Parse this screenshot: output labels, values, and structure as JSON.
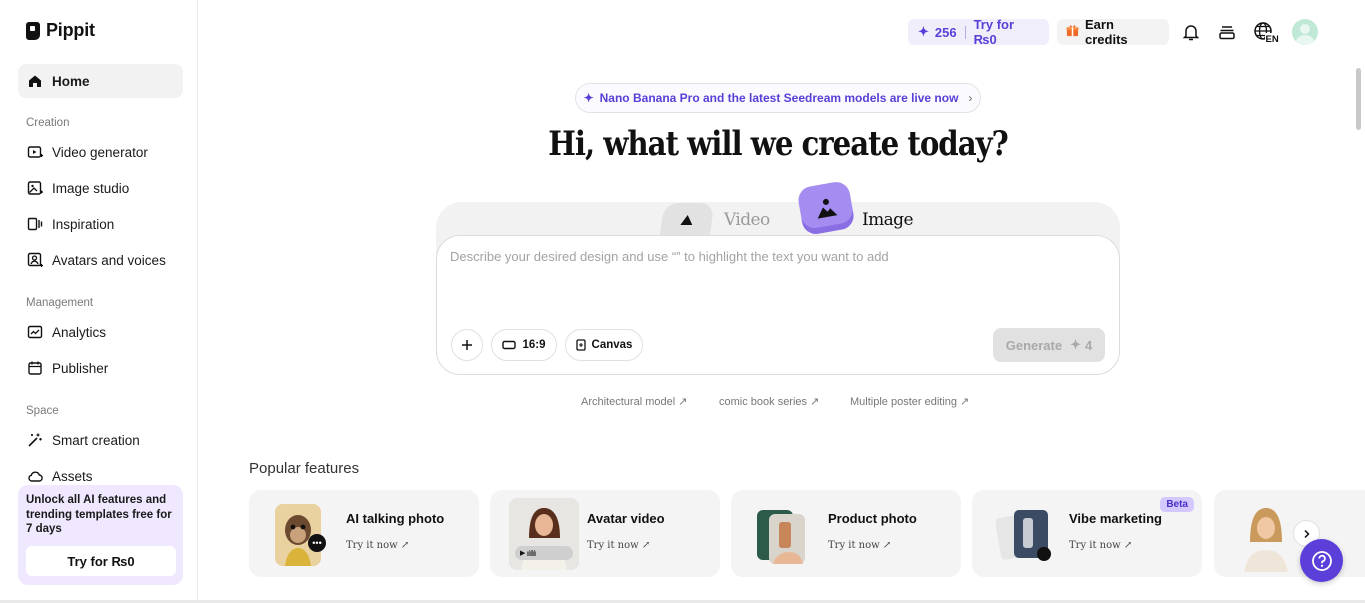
{
  "brand": {
    "name": "Pippit"
  },
  "sidebar": {
    "home": "Home",
    "sections": {
      "creation": "Creation",
      "management": "Management",
      "space": "Space"
    },
    "creation_items": [
      "Video generator",
      "Image studio",
      "Inspiration",
      "Avatars and voices"
    ],
    "management_items": [
      "Analytics",
      "Publisher"
    ],
    "space_items": [
      "Smart creation",
      "Assets"
    ],
    "promo": {
      "text": "Unlock all AI features and trending templates free for 7 days",
      "button": "Try for ₨0"
    }
  },
  "topbar": {
    "credits": "256",
    "try_label": "Try for ₨0",
    "earn_label": "Earn credits",
    "language": "EN"
  },
  "announcement": "Nano Banana Pro and the latest Seedream models are live now",
  "headline": "Hi, what will we create today?",
  "composer": {
    "mode_video": "Video",
    "mode_image": "Image",
    "placeholder": "Describe your desired design and use “” to highlight the text you want to add",
    "aspect": "16:9",
    "canvas": "Canvas",
    "generate": "Generate",
    "generate_cost": "4"
  },
  "suggestions": [
    "Architectural model ↗",
    "comic book series ↗",
    "Multiple poster editing ↗"
  ],
  "popular": {
    "title": "Popular features",
    "cards": [
      {
        "title": "AI talking photo",
        "try": "Try it now ↗"
      },
      {
        "title": "Avatar video",
        "try": "Try it now ↗"
      },
      {
        "title": "Product photo",
        "try": "Try it now ↗"
      },
      {
        "title": "Vibe marketing",
        "try": "Try it now ↗",
        "badge": "Beta"
      }
    ]
  },
  "colors": {
    "accent": "#5b3fd8",
    "promo_bg": "#efe8ff",
    "credits_bg": "#f1eefc"
  }
}
